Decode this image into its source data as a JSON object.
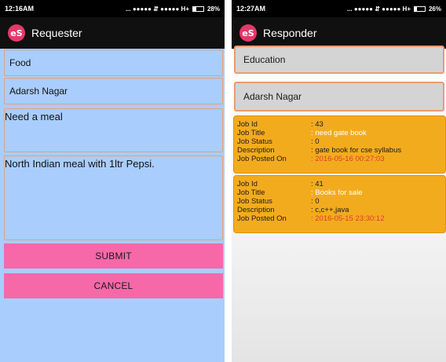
{
  "requester": {
    "status": {
      "time": "12:16AM",
      "signal_text": "... ●●●●● ⇵ ●●●●● H+",
      "battery": "28%",
      "battery_level": 0.28
    },
    "app_title": "Requester",
    "logo_text": "eS",
    "category_value": "Food",
    "location_value": "Adarsh Nagar",
    "title_value": "Need a meal",
    "description_value": "North Indian meal with 1ltr Pepsi.",
    "submit_label": "SUBMIT",
    "cancel_label": "CANCEL"
  },
  "responder": {
    "status": {
      "time": "12:27AM",
      "signal_text": "... ●●●●● ⇵ ●●●●● H+",
      "battery": "26%",
      "battery_level": 0.26
    },
    "app_title": "Responder",
    "logo_text": "eS",
    "category_value": "Education",
    "location_value": "Adarsh Nagar",
    "field_labels": {
      "id": "Job Id",
      "title": "Job Title",
      "status": "Job Status",
      "description": "Description",
      "posted": "Job Posted On"
    },
    "jobs": [
      {
        "id": ": 43",
        "title": ": need gate book",
        "status": ": 0",
        "description": ": gate book for cse syllabus",
        "posted": ": 2016-05-16 00:27:03"
      },
      {
        "id": ": 41",
        "title": ": Books for sale",
        "status": ": 0",
        "description": ": c,c++,java",
        "posted": ": 2016-05-15 23:30:12"
      }
    ]
  },
  "colors": {
    "requester_bg": "#a9cdfc",
    "button_pink": "#f768a8",
    "card_orange": "#f3ab1e",
    "field_border": "#e2a27c",
    "job_title_white": "#ffffff",
    "posted_red": "#e03b2e"
  },
  "icons": {
    "logo": "es-logo-icon",
    "battery": "battery-icon",
    "signal": "signal-icon"
  }
}
